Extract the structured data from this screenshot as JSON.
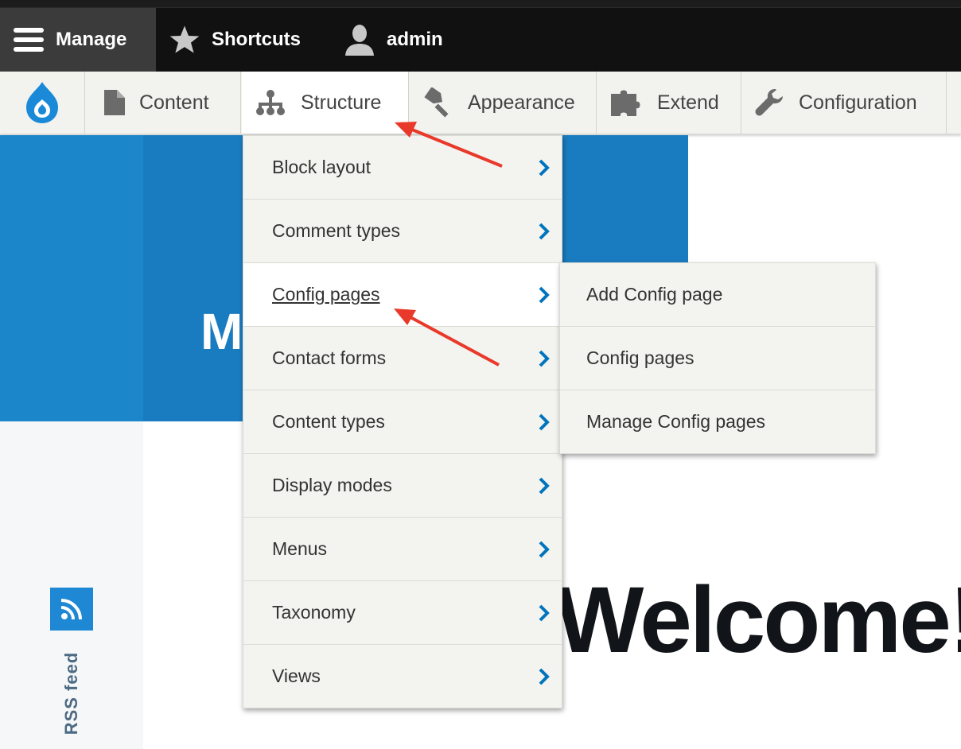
{
  "toolbar": {
    "manage_label": "Manage",
    "shortcuts_label": "Shortcuts",
    "user_label": "admin"
  },
  "tray": {
    "items": [
      {
        "label": "Content",
        "icon": "page-icon"
      },
      {
        "label": "Structure",
        "icon": "sitemap-icon"
      },
      {
        "label": "Appearance",
        "icon": "paintbrush-icon"
      },
      {
        "label": "Extend",
        "icon": "puzzle-icon"
      },
      {
        "label": "Configuration",
        "icon": "wrench-icon"
      }
    ]
  },
  "structure_menu": {
    "items": [
      {
        "label": "Block layout"
      },
      {
        "label": "Comment types"
      },
      {
        "label": "Config pages",
        "active": true
      },
      {
        "label": "Contact forms"
      },
      {
        "label": "Content types"
      },
      {
        "label": "Display modes"
      },
      {
        "label": "Menus"
      },
      {
        "label": "Taxonomy"
      },
      {
        "label": "Views"
      }
    ]
  },
  "config_pages_submenu": {
    "items": [
      {
        "label": "Add Config page"
      },
      {
        "label": "Config pages"
      },
      {
        "label": "Manage Config pages"
      }
    ]
  },
  "page": {
    "hero_letter": "M",
    "welcome": "Welcome!",
    "rss_label": "RSS feed"
  },
  "colors": {
    "accent": "#1b86c9",
    "chevron": "#0074bd",
    "annotation_arrow": "#e8392a",
    "toolbar_bg": "#111111"
  }
}
